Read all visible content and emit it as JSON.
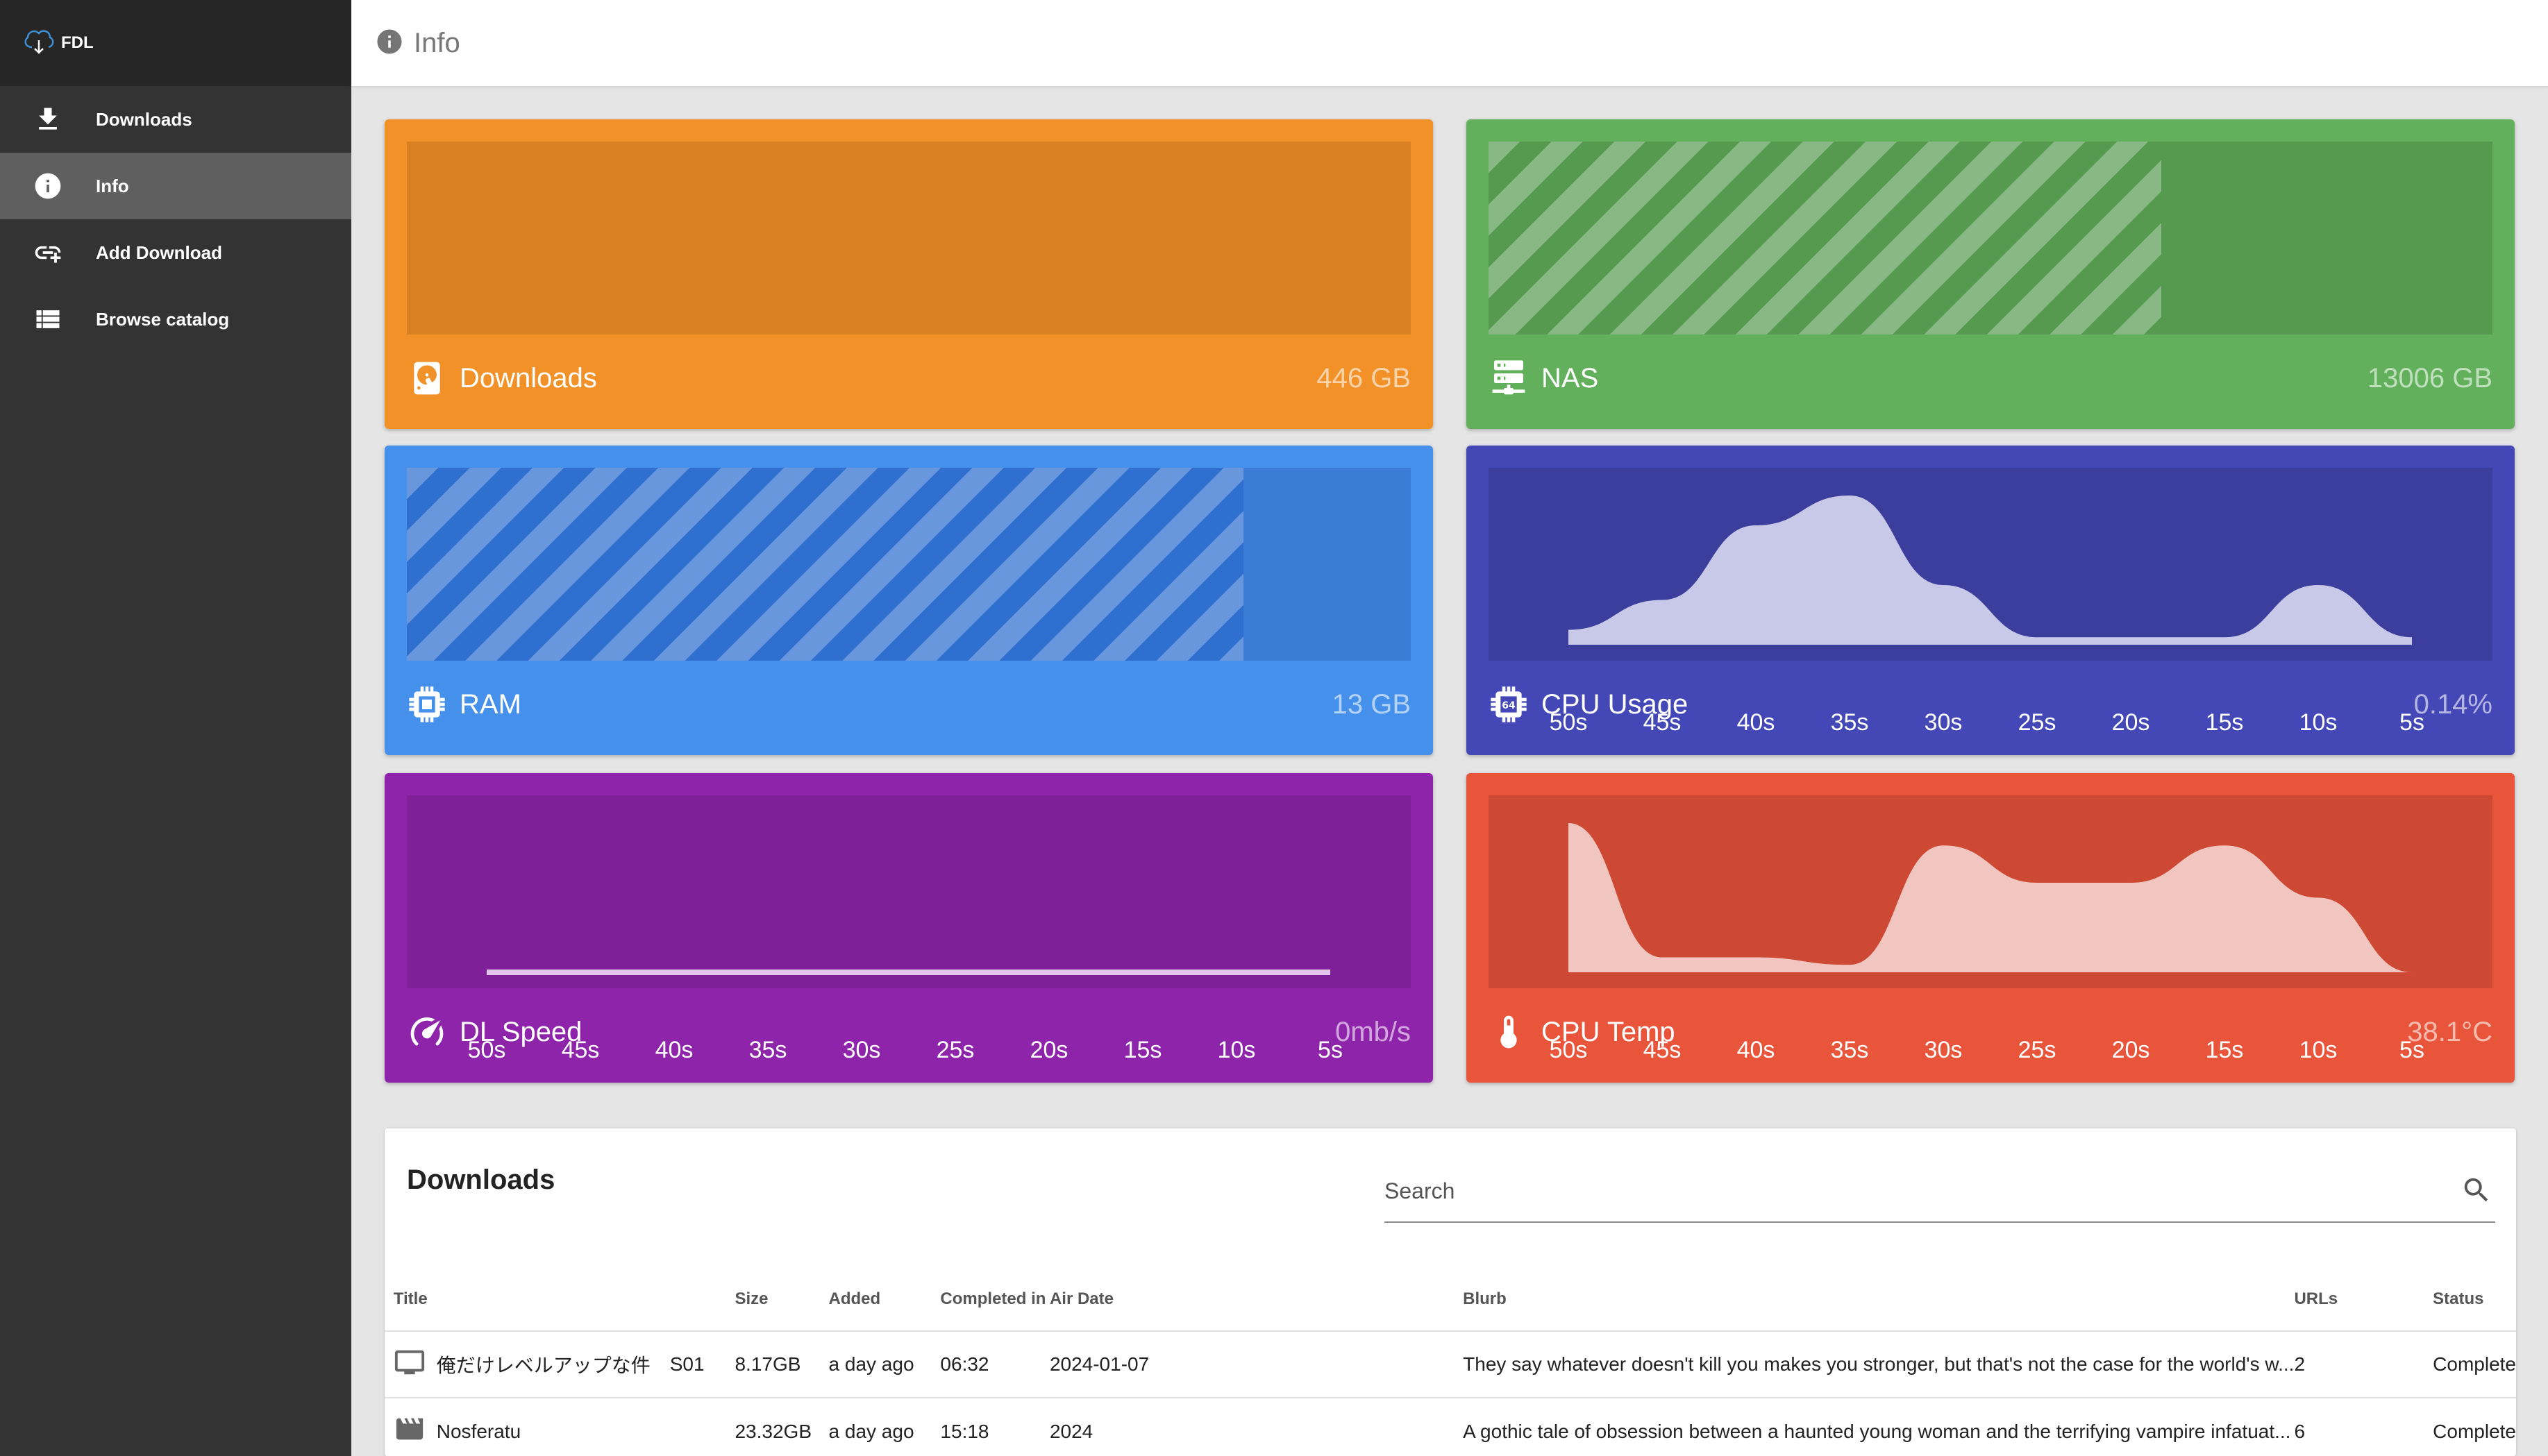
{
  "app": {
    "name": "FDL"
  },
  "sidebar": {
    "items": [
      {
        "label": "Downloads",
        "icon": "download-icon"
      },
      {
        "label": "Info",
        "icon": "info-icon",
        "active": true
      },
      {
        "label": "Add Download",
        "icon": "add-link-icon"
      },
      {
        "label": "Browse catalog",
        "icon": "list-icon"
      }
    ]
  },
  "header": {
    "title": "Info",
    "icon": "info-icon"
  },
  "colors": {
    "downloads": "#f19128",
    "nas": "#62b05b",
    "ram": "#4490eb",
    "cpu_usage": "#4448b6",
    "dl_speed": "#8e24aa",
    "cpu_temp": "#e8553b"
  },
  "cards": {
    "downloads": {
      "label": "Downloads",
      "value": "446 GB",
      "icon": "harddisk-icon",
      "fill": 0.0
    },
    "nas": {
      "label": "NAS",
      "value": "13006 GB",
      "icon": "server-icon",
      "fill": 0.67
    },
    "ram": {
      "label": "RAM",
      "value": "13 GB",
      "icon": "chip-icon",
      "fill": 0.833
    },
    "cpu_usage": {
      "label": "CPU Usage",
      "value": "0.14%",
      "icon": "cpu-64-icon"
    },
    "dl_speed": {
      "label": "DL Speed",
      "value": "0mb/s",
      "icon": "speedometer-icon"
    },
    "cpu_temp": {
      "label": "CPU Temp",
      "value": "38.1°C",
      "icon": "thermometer-icon"
    }
  },
  "time_axis": [
    "50s",
    "45s",
    "40s",
    "35s",
    "30s",
    "25s",
    "20s",
    "15s",
    "10s",
    "5s"
  ],
  "series": {
    "cpu_usage": [
      0.1,
      0.3,
      0.8,
      1.0,
      0.4,
      0.05,
      0.05,
      0.05,
      0.4,
      0.05
    ],
    "dl_speed": [
      0,
      0,
      0,
      0,
      0,
      0,
      0,
      0,
      0,
      0
    ],
    "cpu_temp": [
      1.0,
      0.1,
      0.1,
      0.05,
      0.85,
      0.6,
      0.6,
      0.85,
      0.5,
      0.0
    ]
  },
  "downloads_table": {
    "title": "Downloads",
    "search_placeholder": "Search",
    "columns": [
      "Title",
      "Size",
      "Added",
      "Completed in",
      "Air Date",
      "Blurb",
      "URLs",
      "Status"
    ],
    "rows": [
      {
        "type_icon": "tv-icon",
        "title": "俺だけレベルアップな件",
        "season": "S01",
        "size": "8.17GB",
        "added": "a day ago",
        "completed_in": "06:32",
        "air_date": "2024-01-07",
        "blurb": "They say whatever doesn't kill you makes you stronger, but that's not the case for the world's w...",
        "urls": "2",
        "status": "Complete"
      },
      {
        "type_icon": "movie-icon",
        "title": "Nosferatu",
        "season": "",
        "size": "23.32GB",
        "added": "a day ago",
        "completed_in": "15:18",
        "air_date": "2024",
        "blurb": "A gothic tale of obsession between a haunted young woman and the terrifying vampire infatuat...",
        "urls": "6",
        "status": "Complete"
      }
    ]
  }
}
